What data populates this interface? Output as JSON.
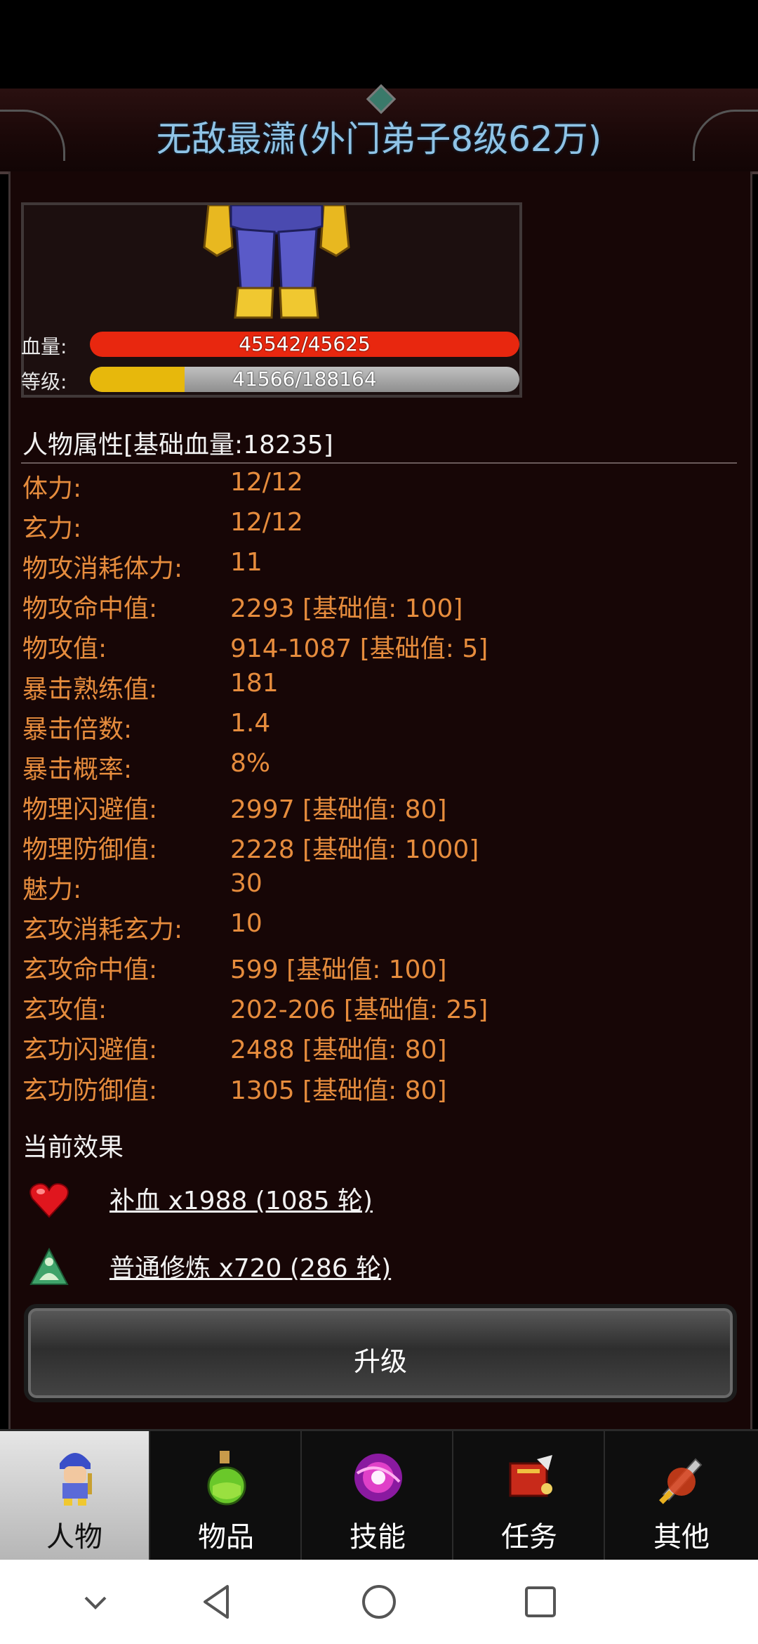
{
  "header": {
    "title": "无敌最潇(外门弟子8级62万)"
  },
  "portrait": {
    "hp_label": "血量:",
    "hp_text": "45542/45625",
    "hp_fraction": 0.998,
    "level_label": "等级:",
    "level_text": "41566/188164",
    "level_fraction": 0.221
  },
  "attributes": {
    "header": "人物属性[基础血量:18235]",
    "rows": [
      {
        "label": "体力:",
        "value": "12/12"
      },
      {
        "label": "玄力:",
        "value": "12/12"
      },
      {
        "label": "物攻消耗体力:",
        "value": "11"
      },
      {
        "label": "物攻命中值:",
        "value": "2293 [基础值: 100]"
      },
      {
        "label": "物攻值:",
        "value": "914-1087 [基础值: 5]"
      },
      {
        "label": "暴击熟练值:",
        "value": "181"
      },
      {
        "label": "暴击倍数:",
        "value": "1.4"
      },
      {
        "label": "暴击概率:",
        "value": "8%"
      },
      {
        "label": "物理闪避值:",
        "value": "2997 [基础值: 80]"
      },
      {
        "label": "物理防御值:",
        "value": "2228 [基础值: 1000]"
      },
      {
        "label": "魅力:",
        "value": "30"
      },
      {
        "label": "玄攻消耗玄力:",
        "value": "10"
      },
      {
        "label": "玄攻命中值:",
        "value": "599 [基础值: 100]"
      },
      {
        "label": "玄攻值:",
        "value": "202-206 [基础值: 25]"
      },
      {
        "label": "玄功闪避值:",
        "value": "2488 [基础值: 80]"
      },
      {
        "label": "玄功防御值:",
        "value": "1305 [基础值: 80]"
      }
    ]
  },
  "effects": {
    "title": "当前效果",
    "items": [
      {
        "icon": "heart-icon",
        "text": "补血 x1988 (1085 轮)"
      },
      {
        "icon": "meditation-icon",
        "text": "普通修炼 x720 (286 轮)"
      }
    ]
  },
  "upgrade_button": "升级",
  "tabs": [
    {
      "icon": "character-icon",
      "label": "人物",
      "active": true
    },
    {
      "icon": "potion-icon",
      "label": "物品",
      "active": false
    },
    {
      "icon": "skill-orb-icon",
      "label": "技能",
      "active": false
    },
    {
      "icon": "quest-icon",
      "label": "任务",
      "active": false
    },
    {
      "icon": "sword-icon",
      "label": "其他",
      "active": false
    }
  ],
  "navbar": [
    "back-chevron-icon",
    "back-triangle-icon",
    "home-circle-icon",
    "recents-square-icon"
  ],
  "colors": {
    "title": "#8fc3e6",
    "attribute_text": "#e68c3d",
    "hp_bar": "#e8270f",
    "level_fill": "#e7b80c"
  }
}
